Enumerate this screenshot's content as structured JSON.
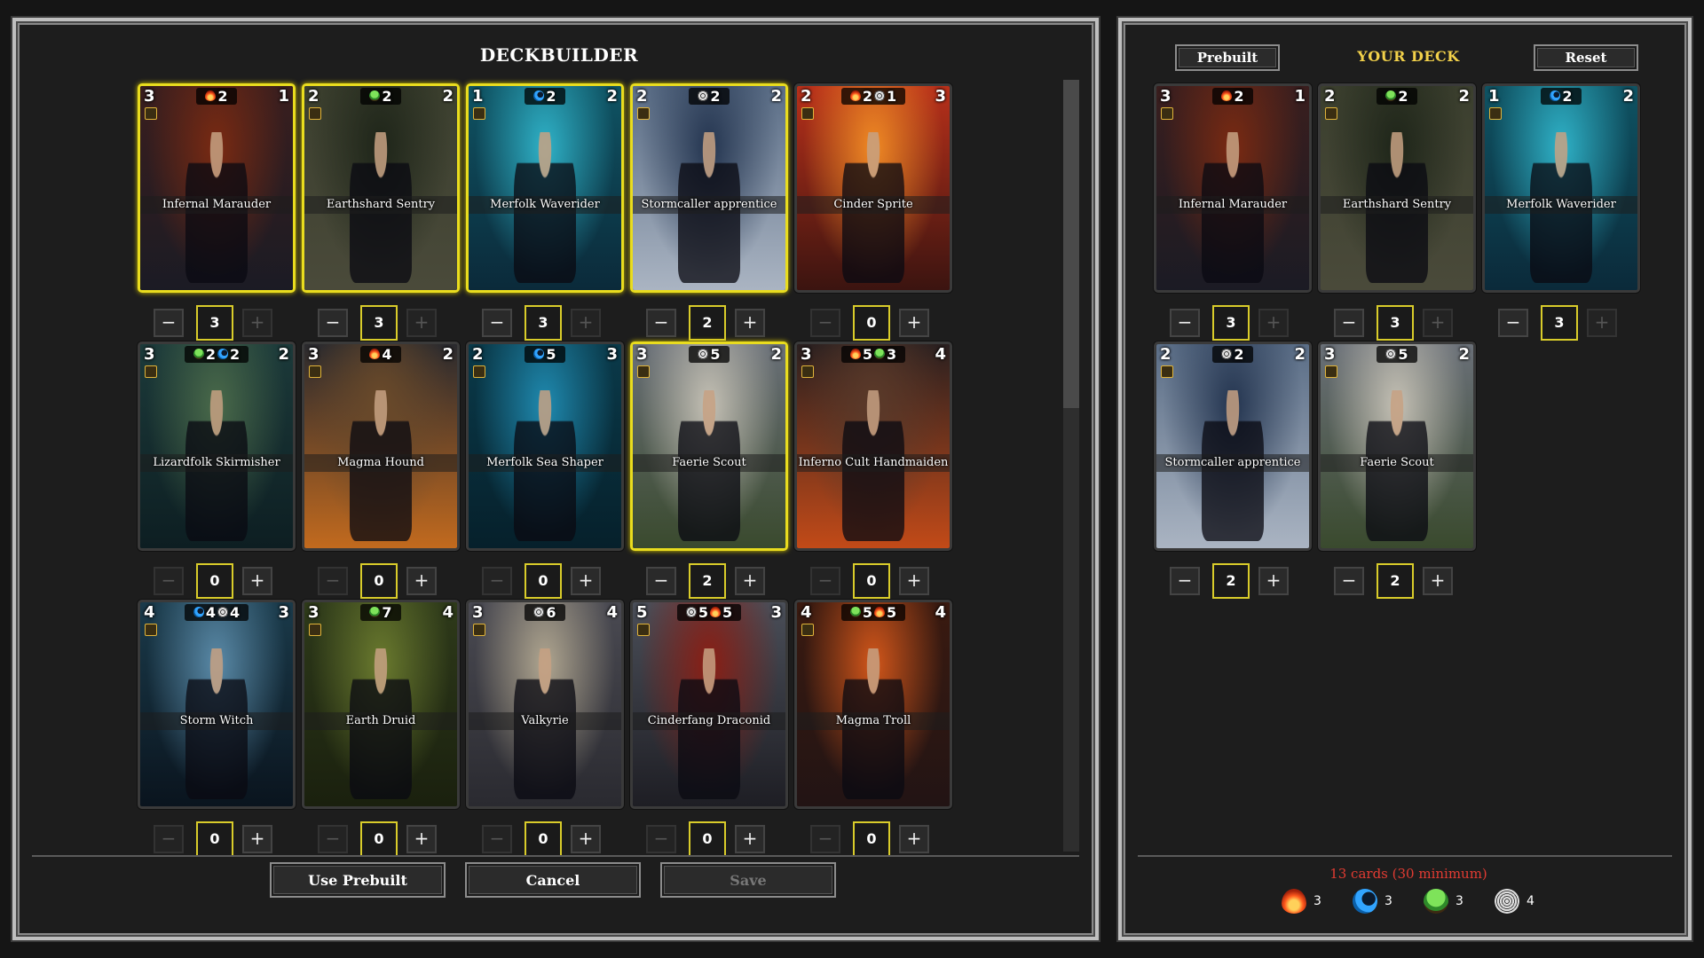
{
  "builder": {
    "title": "DECKBUILDER",
    "footer": {
      "use_prebuilt": "Use Prebuilt",
      "cancel": "Cancel",
      "save": "Save"
    },
    "cards": [
      {
        "name": "Infernal Marauder",
        "cost_left": "3",
        "power": "1",
        "element_costs": [
          {
            "element": "fire",
            "value": "2"
          }
        ],
        "qty": "3",
        "selected": true,
        "minus_enabled": true,
        "plus_enabled": false,
        "art": [
          "#3a1e1e",
          "#7a2a12",
          "#1b1b24"
        ]
      },
      {
        "name": "Earthshard Sentry",
        "cost_left": "2",
        "power": "2",
        "element_costs": [
          {
            "element": "earth",
            "value": "2"
          }
        ],
        "qty": "3",
        "selected": true,
        "minus_enabled": true,
        "plus_enabled": false,
        "art": [
          "#3b3f2e",
          "#1e2519",
          "#4a4a3a"
        ]
      },
      {
        "name": "Merfolk Waverider",
        "cost_left": "1",
        "power": "2",
        "element_costs": [
          {
            "element": "water",
            "value": "2"
          }
        ],
        "qty": "3",
        "selected": true,
        "minus_enabled": true,
        "plus_enabled": false,
        "art": [
          "#0f5363",
          "#2fb2c8",
          "#0b2a3a"
        ]
      },
      {
        "name": "Stormcaller apprentice",
        "cost_left": "2",
        "power": "2",
        "element_costs": [
          {
            "element": "air",
            "value": "2"
          }
        ],
        "qty": "2",
        "selected": true,
        "minus_enabled": true,
        "plus_enabled": true,
        "art": [
          "#5a6d86",
          "#23344f",
          "#aab4c2"
        ]
      },
      {
        "name": "Cinder Sprite",
        "cost_left": "2",
        "power": "3",
        "element_costs": [
          {
            "element": "fire",
            "value": "2"
          },
          {
            "element": "air",
            "value": "1"
          }
        ],
        "qty": "0",
        "selected": false,
        "minus_enabled": false,
        "plus_enabled": true,
        "art": [
          "#b8301a",
          "#f08a24",
          "#3b1410"
        ]
      },
      {
        "name": "Lizardfolk Skirmisher",
        "cost_left": "3",
        "power": "2",
        "element_costs": [
          {
            "element": "earth",
            "value": "2"
          },
          {
            "element": "water",
            "value": "2"
          }
        ],
        "qty": "0",
        "selected": false,
        "minus_enabled": false,
        "plus_enabled": true,
        "art": [
          "#1c3a3a",
          "#4a6a4a",
          "#0d1e22"
        ]
      },
      {
        "name": "Magma Hound",
        "cost_left": "3",
        "power": "2",
        "element_costs": [
          {
            "element": "fire",
            "value": "4"
          }
        ],
        "qty": "0",
        "selected": false,
        "minus_enabled": false,
        "plus_enabled": true,
        "art": [
          "#2a2a2e",
          "#6a4a2a",
          "#c26a1e"
        ]
      },
      {
        "name": "Merfolk Sea Shaper",
        "cost_left": "2",
        "power": "3",
        "element_costs": [
          {
            "element": "water",
            "value": "5"
          }
        ],
        "qty": "0",
        "selected": false,
        "minus_enabled": false,
        "plus_enabled": true,
        "art": [
          "#0a3a4a",
          "#1f8ab0",
          "#06202b"
        ]
      },
      {
        "name": "Faerie Scout",
        "cost_left": "3",
        "power": "2",
        "element_costs": [
          {
            "element": "air",
            "value": "5"
          }
        ],
        "qty": "2",
        "selected": true,
        "minus_enabled": true,
        "plus_enabled": true,
        "art": [
          "#6a7078",
          "#c4c0b4",
          "#3a4a2e"
        ]
      },
      {
        "name": "Inferno Cult Handmaiden",
        "cost_left": "3",
        "power": "4",
        "element_costs": [
          {
            "element": "fire",
            "value": "5"
          },
          {
            "element": "earth",
            "value": "3"
          }
        ],
        "qty": "0",
        "selected": false,
        "minus_enabled": false,
        "plus_enabled": true,
        "art": [
          "#2a2020",
          "#5a3a2a",
          "#c24a18"
        ]
      },
      {
        "name": "Storm Witch",
        "cost_left": "4",
        "power": "3",
        "element_costs": [
          {
            "element": "water",
            "value": "4"
          },
          {
            "element": "air",
            "value": "4"
          }
        ],
        "qty": "0",
        "selected": false,
        "minus_enabled": false,
        "plus_enabled": true,
        "art": [
          "#1a3a4a",
          "#5a8aa8",
          "#0a141e"
        ]
      },
      {
        "name": "Earth Druid",
        "cost_left": "3",
        "power": "4",
        "element_costs": [
          {
            "element": "earth",
            "value": "7"
          }
        ],
        "qty": "0",
        "selected": false,
        "minus_enabled": false,
        "plus_enabled": true,
        "art": [
          "#2e3a1a",
          "#6a7a2e",
          "#1a200e"
        ]
      },
      {
        "name": "Valkyrie",
        "cost_left": "3",
        "power": "4",
        "element_costs": [
          {
            "element": "air",
            "value": "6"
          }
        ],
        "qty": "0",
        "selected": false,
        "minus_enabled": false,
        "plus_enabled": true,
        "art": [
          "#4a4a52",
          "#b0a690",
          "#2a2a30"
        ]
      },
      {
        "name": "Cinderfang Draconid",
        "cost_left": "5",
        "power": "3",
        "element_costs": [
          {
            "element": "air",
            "value": "5"
          },
          {
            "element": "fire",
            "value": "5"
          }
        ],
        "qty": "0",
        "selected": false,
        "minus_enabled": false,
        "plus_enabled": true,
        "art": [
          "#4a4e58",
          "#8a1e14",
          "#1e1e24"
        ]
      },
      {
        "name": "Magma Troll",
        "cost_left": "4",
        "power": "4",
        "element_costs": [
          {
            "element": "earth",
            "value": "5"
          },
          {
            "element": "fire",
            "value": "5"
          }
        ],
        "qty": "0",
        "selected": false,
        "minus_enabled": false,
        "plus_enabled": true,
        "art": [
          "#3a1a10",
          "#d2561a",
          "#221414"
        ]
      }
    ]
  },
  "deck": {
    "prebuilt_label": "Prebuilt",
    "title": "YOUR DECK",
    "reset_label": "Reset",
    "count_text": "13 cards (30 minimum)",
    "element_totals": [
      {
        "element": "fire",
        "value": "3"
      },
      {
        "element": "water",
        "value": "3"
      },
      {
        "element": "earth",
        "value": "3"
      },
      {
        "element": "air",
        "value": "4"
      }
    ],
    "cards": [
      {
        "name": "Infernal Marauder",
        "cost_left": "3",
        "power": "1",
        "element_costs": [
          {
            "element": "fire",
            "value": "2"
          }
        ],
        "qty": "3",
        "minus_enabled": true,
        "plus_enabled": false,
        "art": [
          "#3a1e1e",
          "#7a2a12",
          "#1b1b24"
        ]
      },
      {
        "name": "Earthshard Sentry",
        "cost_left": "2",
        "power": "2",
        "element_costs": [
          {
            "element": "earth",
            "value": "2"
          }
        ],
        "qty": "3",
        "minus_enabled": true,
        "plus_enabled": false,
        "art": [
          "#3b3f2e",
          "#1e2519",
          "#4a4a3a"
        ]
      },
      {
        "name": "Merfolk Waverider",
        "cost_left": "1",
        "power": "2",
        "element_costs": [
          {
            "element": "water",
            "value": "2"
          }
        ],
        "qty": "3",
        "minus_enabled": true,
        "plus_enabled": false,
        "art": [
          "#0f5363",
          "#2fb2c8",
          "#0b2a3a"
        ]
      },
      {
        "name": "Stormcaller apprentice",
        "cost_left": "2",
        "power": "2",
        "element_costs": [
          {
            "element": "air",
            "value": "2"
          }
        ],
        "qty": "2",
        "minus_enabled": true,
        "plus_enabled": true,
        "art": [
          "#5a6d86",
          "#23344f",
          "#aab4c2"
        ]
      },
      {
        "name": "Faerie Scout",
        "cost_left": "3",
        "power": "2",
        "element_costs": [
          {
            "element": "air",
            "value": "5"
          }
        ],
        "qty": "2",
        "minus_enabled": true,
        "plus_enabled": true,
        "art": [
          "#6a7078",
          "#c4c0b4",
          "#3a4a2e"
        ]
      }
    ]
  },
  "colors": {
    "highlight": "#e9dc1e",
    "deck_title": "#f2d14a",
    "warning": "#e23b32"
  }
}
